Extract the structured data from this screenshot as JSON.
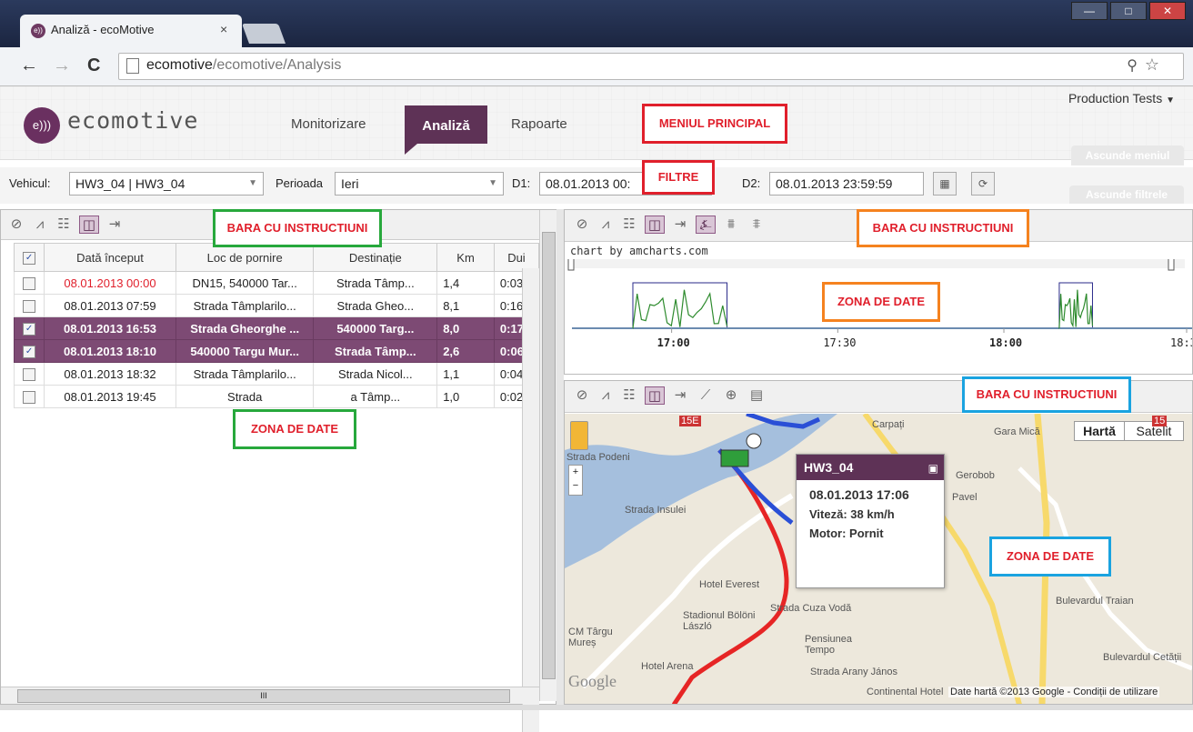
{
  "browser": {
    "tab_title": "Analiză - ecoMotive",
    "tab_close": "×",
    "url_host": "ecomotive",
    "url_path": "/ecomotive/Analysis",
    "back": "←",
    "forward": "→",
    "reload": "C",
    "zoom_icon": "zoom-icon",
    "star_icon": "star-icon",
    "menu_icon": "menu-icon",
    "minimize": "—",
    "restore": "□",
    "close": "✕"
  },
  "header": {
    "logo_text": "ecomotive",
    "menu": [
      "Monitorizare",
      "Analiză",
      "Rapoarte"
    ],
    "active_menu": "Analiză",
    "account": "Production Tests",
    "hide_menu": "Ascunde meniul",
    "hide_filters": "Ascunde filtrele"
  },
  "filters": {
    "vehicle_label": "Vehicul:",
    "vehicle_value": "HW3_04 | HW3_04",
    "period_label": "Perioada",
    "period_value": "Ieri",
    "d1_label": "D1:",
    "d1_value": "08.01.2013 00:",
    "d2_label": "D2:",
    "d2_value": "08.01.2013 23:59:59"
  },
  "annotations": {
    "main_menu": "MENIUL PRINCIPAL",
    "filters": "FILTRE",
    "toolbar_left": "BARA CU INSTRUCTIUNI",
    "data_left": "ZONA DE DATE",
    "toolbar_chart": "BARA CU INSTRUCTIUNI",
    "data_chart": "ZONA DE DATE",
    "toolbar_map": "BARA CU INSTRUCTIUNI",
    "data_map": "ZONA DE DATE"
  },
  "table": {
    "headers": [
      "Dată început",
      "Loc de pornire",
      "Destinație",
      "Km",
      "Dui"
    ],
    "rows": [
      {
        "start": "08.01.2013 00:00",
        "from": "DN15, 540000 Tar...",
        "to": "Strada Tâmp...",
        "km": "1,4",
        "dur": "0:03",
        "checked": false,
        "selected": false,
        "start_color": "#e01f2b"
      },
      {
        "start": "08.01.2013 07:59",
        "from": "Strada Tâmplarilo...",
        "to": "Strada Gheo...",
        "km": "8,1",
        "dur": "0:16",
        "checked": false,
        "selected": false
      },
      {
        "start": "08.01.2013 16:53",
        "from": "Strada Gheorghe ...",
        "to": "540000 Targ...",
        "km": "8,0",
        "dur": "0:17",
        "checked": true,
        "selected": true
      },
      {
        "start": "08.01.2013 18:10",
        "from": "540000 Targu Mur...",
        "to": "Strada Tâmp...",
        "km": "2,6",
        "dur": "0:06",
        "checked": true,
        "selected": true
      },
      {
        "start": "08.01.2013 18:32",
        "from": "Strada Tâmplarilo...",
        "to": "Strada Nicol...",
        "km": "1,1",
        "dur": "0:04",
        "checked": false,
        "selected": false
      },
      {
        "start": "08.01.2013 19:45",
        "from": "Strada",
        "to": "a Tâmp...",
        "km": "1,0",
        "dur": "0:02",
        "checked": false,
        "selected": false
      }
    ],
    "hscroll_dots": "III"
  },
  "chart": {
    "credit": "chart by amcharts.com"
  },
  "chart_data": {
    "type": "area",
    "title": "",
    "x_ticks": [
      "17:00",
      "17:30",
      "18:00",
      "18:3"
    ],
    "selection_windows": [
      [
        "16:53",
        "17:10"
      ],
      [
        "18:10",
        "18:16"
      ]
    ],
    "grid": false,
    "legend": "none"
  },
  "map": {
    "map_btn": "Hartă",
    "sat_btn": "Satelit",
    "popup_title": "HW3_04",
    "popup_date": "08.01.2013 17:06",
    "popup_speed": "Viteză: 38 km/h",
    "popup_engine": "Motor: Pornit",
    "attribution": "Date hartă ©2013 Google - Condiții de utilizare",
    "google": "Google",
    "labels": [
      "Carpați",
      "Gara Mică",
      "Strada Podeni",
      "Strada Insulei",
      "Gerobob",
      "Pavel",
      "Hotel Everest",
      "Stadionul Bölöni László",
      "CM Târgu Mureș",
      "Pensiunea Tempo",
      "Hotel Arena",
      "Strada Arany János",
      "Strada Cuza Vodă",
      "Bulevardul Cetății",
      "Bulevardul Traian",
      "Continental Hotel",
      "15E",
      "15"
    ]
  },
  "colors": {
    "brand": "#5e3256",
    "selected_row": "#7d4a74",
    "annotation_red": "#e01f2b",
    "annotation_green": "#27a83c",
    "annotation_orange": "#f5821f",
    "annotation_blue": "#1aa3e0",
    "chart_line": "#2e8b2e",
    "chart_window": "#2a2a8a"
  }
}
